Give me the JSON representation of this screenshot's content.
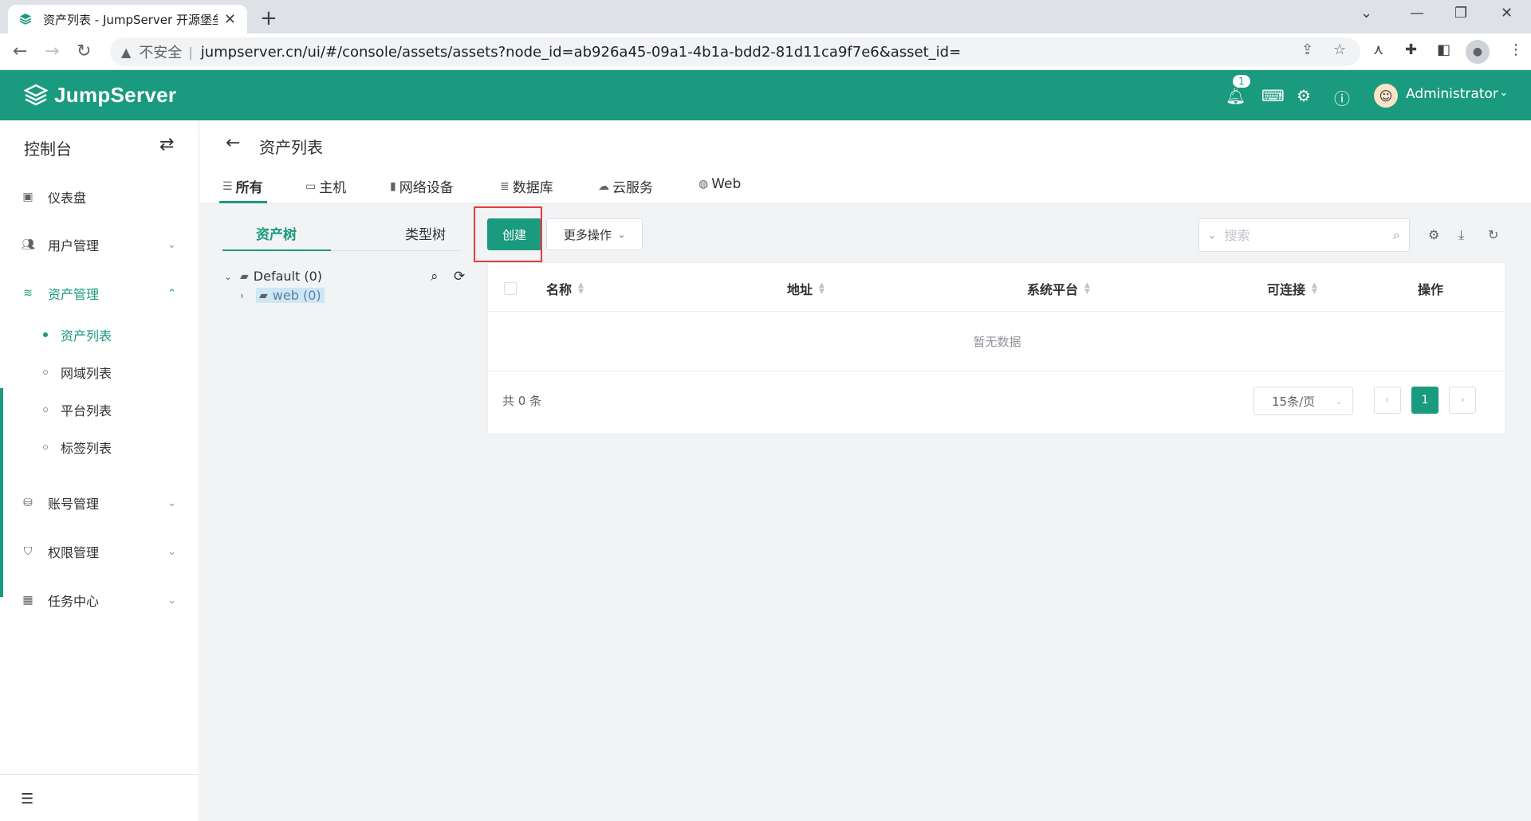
{
  "browser": {
    "tab_title": "资产列表 - JumpServer 开源堡垒",
    "new_tab": "+",
    "insecure_label": "不安全",
    "url": "jumpserver.cn/ui/#/console/assets/assets?node_id=ab926a45-09a1-4b1a-bdd2-81d11ca9f7e6&asset_id="
  },
  "header": {
    "brand": "JumpServer",
    "notification_count": "1",
    "user_name": "Administrator",
    "accent_color": "#1a9a7e"
  },
  "sidebar": {
    "title": "控制台",
    "items": [
      {
        "label": "仪表盘",
        "icon": "dashboard-icon"
      },
      {
        "label": "用户管理",
        "icon": "users-icon"
      },
      {
        "label": "资产管理",
        "icon": "layers-icon"
      },
      {
        "label": "账号管理",
        "icon": "account-icon"
      },
      {
        "label": "权限管理",
        "icon": "shield-icon"
      },
      {
        "label": "任务中心",
        "icon": "calendar-icon"
      }
    ],
    "sub_items": [
      {
        "label": "资产列表"
      },
      {
        "label": "网域列表"
      },
      {
        "label": "平台列表"
      },
      {
        "label": "标签列表"
      }
    ]
  },
  "page": {
    "title": "资产列表",
    "tabs": [
      {
        "label": "所有",
        "icon": "list-icon"
      },
      {
        "label": "主机",
        "icon": "host-icon"
      },
      {
        "label": "网络设备",
        "icon": "network-device-icon"
      },
      {
        "label": "数据库",
        "icon": "database-icon"
      },
      {
        "label": "云服务",
        "icon": "cloud-icon"
      },
      {
        "label": "Web",
        "icon": "globe-icon"
      }
    ]
  },
  "tree": {
    "tabs": [
      "资产树",
      "类型树"
    ],
    "root": "Default (0)",
    "child": "web (0)"
  },
  "toolbar": {
    "create": "创建",
    "more": "更多操作",
    "search_placeholder": "搜索"
  },
  "table": {
    "columns": [
      "名称",
      "地址",
      "系统平台",
      "可连接",
      "操作"
    ],
    "empty_text": "暂无数据",
    "total": "共 0 条",
    "page_size": "15条/页",
    "current_page": "1"
  }
}
